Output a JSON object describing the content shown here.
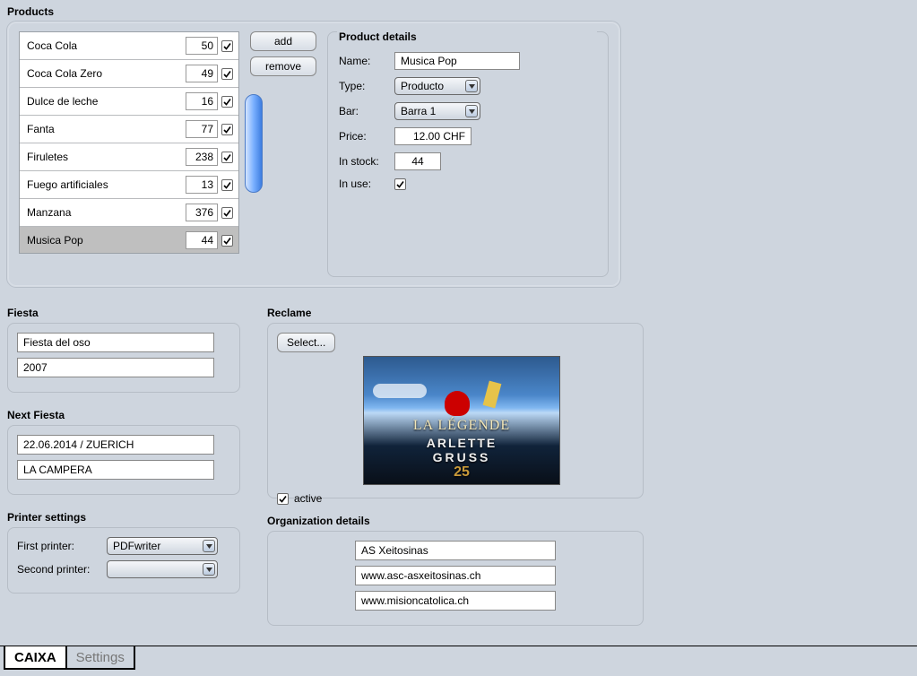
{
  "sections": {
    "products": "Products",
    "fiesta": "Fiesta",
    "next_fiesta": "Next Fiesta",
    "printer": "Printer settings",
    "reclame": "Reclame",
    "org": "Organization details",
    "details": "Product details"
  },
  "products": [
    {
      "name": "Coca Cola",
      "qty": "50",
      "checked": true
    },
    {
      "name": "Coca Cola Zero",
      "qty": "49",
      "checked": true
    },
    {
      "name": "Dulce de leche",
      "qty": "16",
      "checked": true
    },
    {
      "name": "Fanta",
      "qty": "77",
      "checked": true
    },
    {
      "name": "Firuletes",
      "qty": "238",
      "checked": true
    },
    {
      "name": "Fuego artificiales",
      "qty": "13",
      "checked": true
    },
    {
      "name": "Manzana",
      "qty": "376",
      "checked": true
    },
    {
      "name": "Musica Pop",
      "qty": "44",
      "checked": true,
      "selected": true
    }
  ],
  "buttons": {
    "add": "add",
    "remove": "remove",
    "select": "Select..."
  },
  "details": {
    "name_label": "Name:",
    "type_label": "Type:",
    "bar_label": "Bar:",
    "price_label": "Price:",
    "stock_label": "In stock:",
    "use_label": "In use:",
    "name": "Musica Pop",
    "type": "Producto",
    "bar": "Barra 1",
    "price": "12.00 CHF",
    "stock": "44",
    "in_use": true
  },
  "fiesta": {
    "f1": "Fiesta del oso",
    "f2": "2007"
  },
  "next_fiesta": {
    "f1": "22.06.2014 / ZUERICH",
    "f2": "LA CAMPERA"
  },
  "reclame": {
    "active_label": "active",
    "active": true,
    "img_t1": "LA LÉGENDE",
    "img_t2": "ARLETTE",
    "img_t3": "GRUSS",
    "img_t4": "25"
  },
  "printer": {
    "first_label": "First printer:",
    "second_label": "Second printer:",
    "first": "PDFwriter",
    "second": ""
  },
  "org": {
    "f1": "AS Xeitosinas",
    "f2": "www.asc-asxeitosinas.ch",
    "f3": "www.misioncatolica.ch"
  },
  "tabs": {
    "caixa": "CAIXA",
    "settings": "Settings"
  }
}
